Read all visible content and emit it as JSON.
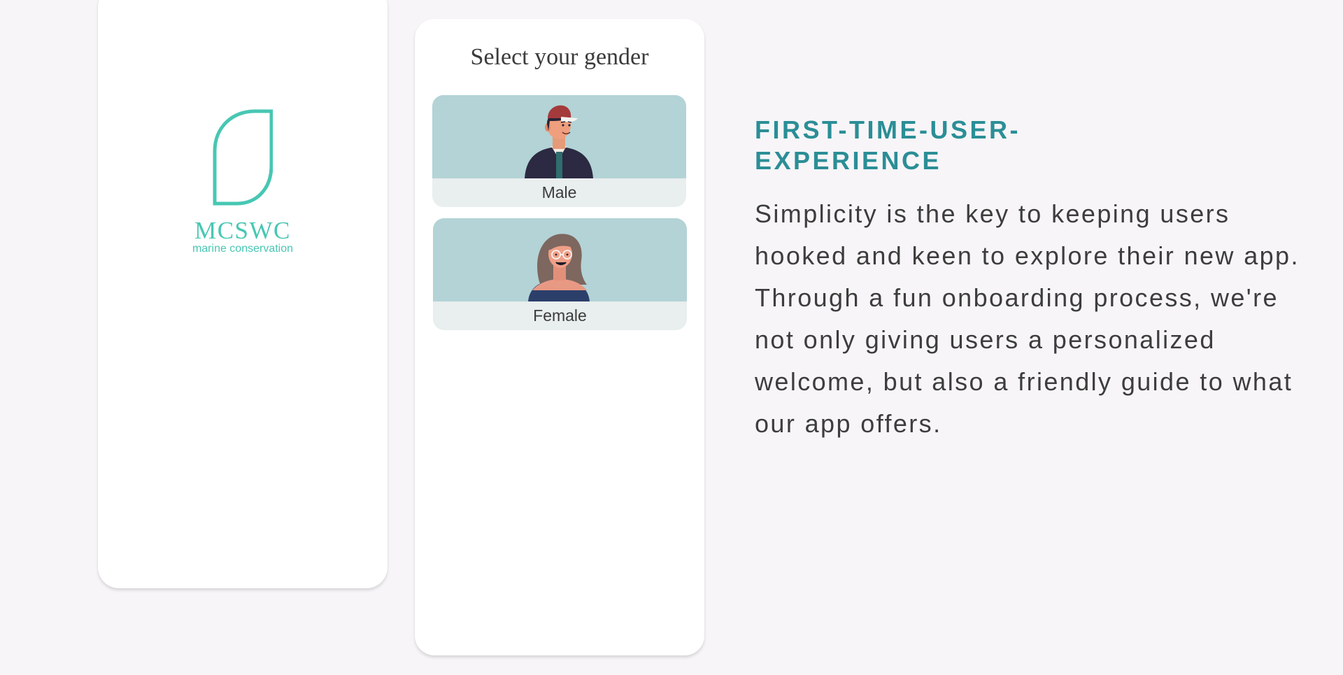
{
  "splash": {
    "brand_name": "MCSWC",
    "brand_tagline": "marine conservation"
  },
  "gender_screen": {
    "title": "Select your gender",
    "options": [
      {
        "label": "Male"
      },
      {
        "label": "Female"
      }
    ]
  },
  "description": {
    "heading": "FIRST-TIME-USER-EXPERIENCE",
    "body": "Simplicity is the key to keeping users hooked and keen to explore their new app. Through a fun onboarding process, we're not only giving users a personalized welcome, but also a friendly guide to what our app offers."
  },
  "colors": {
    "page_background": "#f7f5f8",
    "brand_teal": "#47c7b3",
    "heading_teal": "#2b8e96",
    "card_art_background": "#b3d3d6",
    "card_label_background": "#e9eeee"
  },
  "icons": {
    "logo": "leaf-logo-icon",
    "male": "male-avatar-icon",
    "female": "female-avatar-icon"
  }
}
